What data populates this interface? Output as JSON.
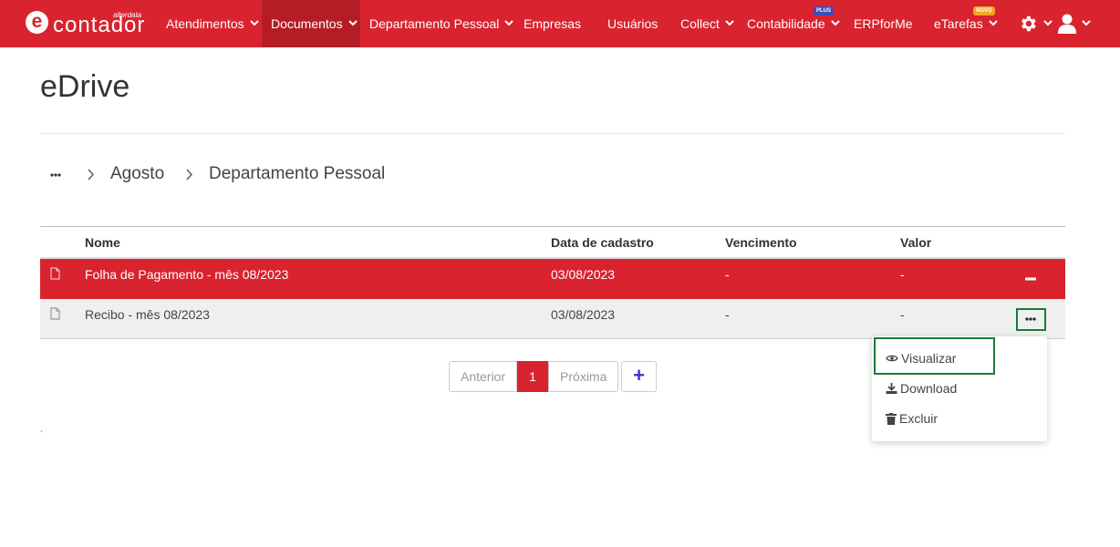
{
  "brand": {
    "name": "contador",
    "sub": "alterdata",
    "letter": "e"
  },
  "nav": {
    "items": [
      {
        "label": "Atendimentos"
      },
      {
        "label": "Documentos"
      },
      {
        "label": "Departamento Pessoal"
      },
      {
        "label": "Empresas"
      },
      {
        "label": "Usuários"
      },
      {
        "label": "Collect"
      },
      {
        "label": "Contabilidade",
        "badge": "PLUS"
      },
      {
        "label": "ERPforMe"
      },
      {
        "label": "eTarefas",
        "badge": "NOVO"
      }
    ]
  },
  "page": {
    "title": "eDrive"
  },
  "breadcrumb": {
    "more": "···",
    "items": [
      "Agosto",
      "Departamento Pessoal"
    ]
  },
  "table": {
    "headers": {
      "name": "Nome",
      "date": "Data de cadastro",
      "due": "Vencimento",
      "value": "Valor"
    },
    "rows": [
      {
        "name": "Folha de Pagamento - mês 08/2023",
        "date": "03/08/2023",
        "due": "-",
        "value": "-"
      },
      {
        "name": "Recibo - mês 08/2023",
        "date": "03/08/2023",
        "due": "-",
        "value": "-"
      }
    ]
  },
  "pagination": {
    "prev": "Anterior",
    "current": "1",
    "next": "Próxima",
    "add": "+"
  },
  "context_menu": {
    "items": [
      "Visualizar",
      "Download",
      "Excluir"
    ]
  },
  "stray_mark": "`",
  "colors": {
    "brand_red": "#d9232e",
    "highlight_green": "#1a7a3a",
    "row_grey": "#eef0ef"
  }
}
